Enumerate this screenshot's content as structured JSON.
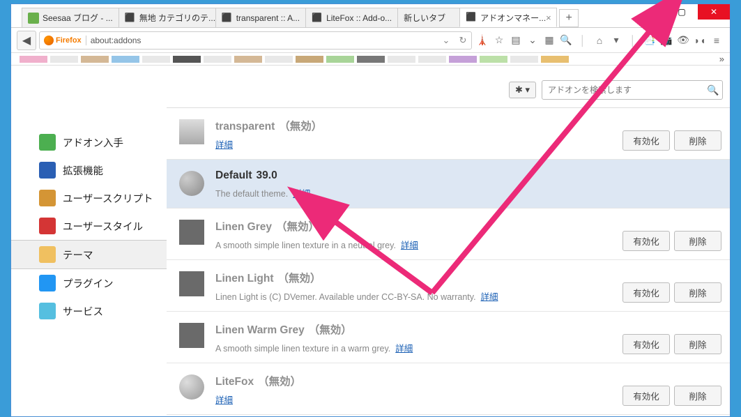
{
  "window": {
    "tabs": [
      {
        "label": "Seesaa ブログ - ...",
        "icon": "seesaa"
      },
      {
        "label": "無地 カテゴリのテ...",
        "icon": "puzzle"
      },
      {
        "label": "transparent :: A...",
        "icon": "puzzle"
      },
      {
        "label": "LiteFox :: Add-o...",
        "icon": "puzzle"
      },
      {
        "label": "新しいタブ",
        "icon": "none"
      },
      {
        "label": "アドオンマネー...",
        "icon": "puzzle-blue",
        "active": true
      }
    ]
  },
  "urlbar": {
    "brand": "Firefox",
    "url": "about:addons"
  },
  "toolbar_icons": [
    "rss",
    "star",
    "book",
    "pocket",
    "grid",
    "find",
    "sep",
    "home",
    "down",
    "sep",
    "book2",
    "camera",
    "eye",
    "mask",
    "menu"
  ],
  "sidebar": {
    "items": [
      {
        "id": "get",
        "label": "アドオン入手"
      },
      {
        "id": "ext",
        "label": "拡張機能"
      },
      {
        "id": "us",
        "label": "ユーザースクリプト"
      },
      {
        "id": "st",
        "label": "ユーザースタイル"
      },
      {
        "id": "th",
        "label": "テーマ",
        "active": true
      },
      {
        "id": "pl",
        "label": "プラグイン"
      },
      {
        "id": "sv",
        "label": "サービス"
      }
    ]
  },
  "search": {
    "placeholder": "アドオンを検索します",
    "gear": "✱ ▾"
  },
  "labels": {
    "enable": "有効化",
    "remove": "削除",
    "details": "詳細"
  },
  "themes": [
    {
      "name": "transparent",
      "status": "（無効）",
      "desc": "",
      "thumb": "grad",
      "detailsOnly": true,
      "buttons": true
    },
    {
      "name": "Default",
      "version": "39.0",
      "status": "",
      "desc": "The default theme.",
      "thumb": "ff",
      "active": true,
      "buttons": false
    },
    {
      "name": "Linen Grey",
      "status": "（無効）",
      "desc": "A smooth simple linen texture in a neutral grey.",
      "thumb": "dark",
      "buttons": true
    },
    {
      "name": "Linen Light",
      "status": "（無効）",
      "desc": "Linen Light is (C) DVemer. Available under CC-BY-SA. No warranty.",
      "thumb": "dark",
      "buttons": true
    },
    {
      "name": "Linen Warm Grey",
      "status": "（無効）",
      "desc": "A smooth simple linen texture in a warm grey.",
      "thumb": "dark",
      "buttons": true
    },
    {
      "name": "LiteFox",
      "status": "（無効）",
      "desc": "",
      "thumb": "lf",
      "detailsOnly": true,
      "buttons": true
    }
  ],
  "bookmark_colors": [
    "#f0b0cc",
    "#e8e8e8",
    "#d4b896",
    "#95c5e8",
    "#e8e8e8",
    "#555",
    "#e8e8e8",
    "#d4b896",
    "#e8e8e8",
    "#c8a878",
    "#a8d498",
    "#777",
    "#e8e8e8",
    "#e8e8e8",
    "#c5a0d8",
    "#bce0a8",
    "#e8e8e8",
    "#e8bf70"
  ]
}
